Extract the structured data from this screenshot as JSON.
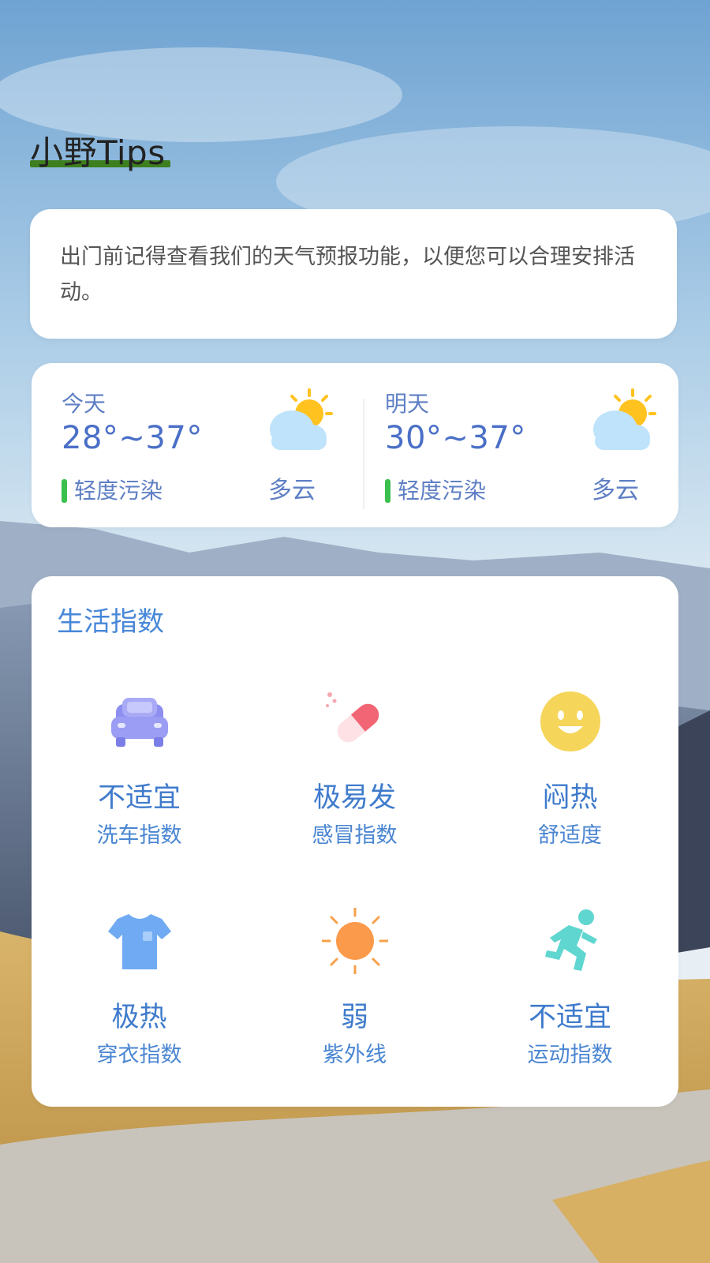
{
  "tips": {
    "title": "小野Tips",
    "message": "出门前记得查看我们的天气预报功能，以便您可以合理安排活动。"
  },
  "forecast": [
    {
      "day": "今天",
      "temp": "28°~37°",
      "air_quality": "轻度污染",
      "condition": "多云",
      "icon": "partly-cloudy-icon",
      "air_quality_color": "#3bbf4d"
    },
    {
      "day": "明天",
      "temp": "30°~37°",
      "air_quality": "轻度污染",
      "condition": "多云",
      "icon": "partly-cloudy-icon",
      "air_quality_color": "#3bbf4d"
    }
  ],
  "life_index": {
    "title": "生活指数",
    "items": [
      {
        "value": "不适宜",
        "label": "洗车指数",
        "icon": "car-icon"
      },
      {
        "value": "极易发",
        "label": "感冒指数",
        "icon": "pill-icon"
      },
      {
        "value": "闷热",
        "label": "舒适度",
        "icon": "smiley-icon"
      },
      {
        "value": "极热",
        "label": "穿衣指数",
        "icon": "tshirt-icon"
      },
      {
        "value": "弱",
        "label": "紫外线",
        "icon": "sun-icon"
      },
      {
        "value": "不适宜",
        "label": "运动指数",
        "icon": "running-icon"
      }
    ]
  },
  "colors": {
    "accent_text": "#4a6fc7",
    "title_underline": "#3d7f1e",
    "card_background": "#ffffff"
  }
}
